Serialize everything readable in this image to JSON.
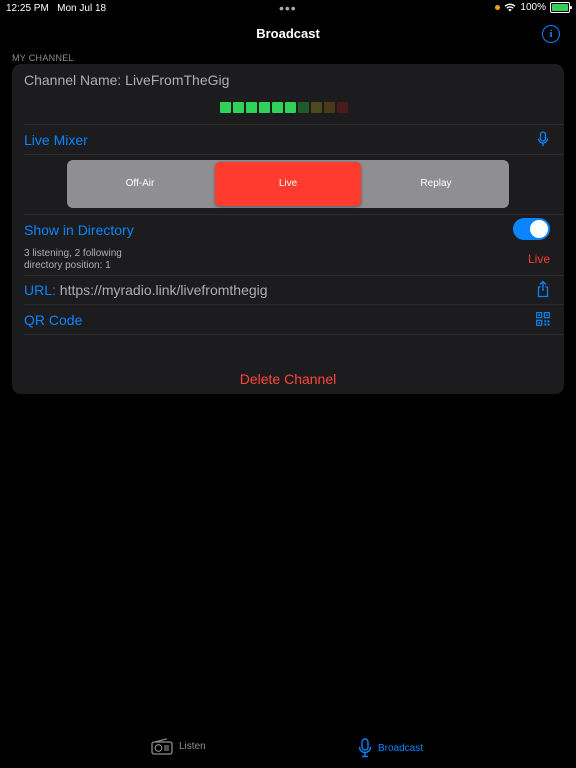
{
  "status_bar": {
    "time": "12:25 PM",
    "date": "Mon Jul 18",
    "battery": "100%",
    "icons": [
      "privacy-dot-icon",
      "wifi-icon",
      "battery-charging-icon"
    ]
  },
  "nav": {
    "title": "Broadcast",
    "info_icon": "info-icon"
  },
  "section": {
    "header": "MY CHANNEL"
  },
  "channel": {
    "name_label": "Channel Name: LiveFromTheGig",
    "meter_colors": [
      "#30d158",
      "#30d158",
      "#30d158",
      "#30d158",
      "#30d158",
      "#30d158",
      "#1e5a2a",
      "#4a4a1e",
      "#4a3a1a",
      "#4a1a1a"
    ],
    "live_mixer_label": "Live Mixer",
    "segments": [
      "Off-Air",
      "Live",
      "Replay"
    ],
    "selected_segment": "Live",
    "show_in_directory_label": "Show in Directory",
    "show_in_directory_on": true,
    "stats_line1": "3 listening, 2 following",
    "stats_line2": "directory position: 1",
    "live_status": "Live",
    "url_label": "URL:",
    "url_value": "https://myradio.link/livefromthegig",
    "qr_label": "QR Code",
    "delete_label": "Delete Channel"
  },
  "tabs": {
    "listen": "Listen",
    "broadcast": "Broadcast",
    "selected": "Broadcast"
  },
  "colors": {
    "accent": "#0a84ff",
    "destructive": "#ff3b30",
    "background": "#000000",
    "card": "#1c1c1e"
  }
}
